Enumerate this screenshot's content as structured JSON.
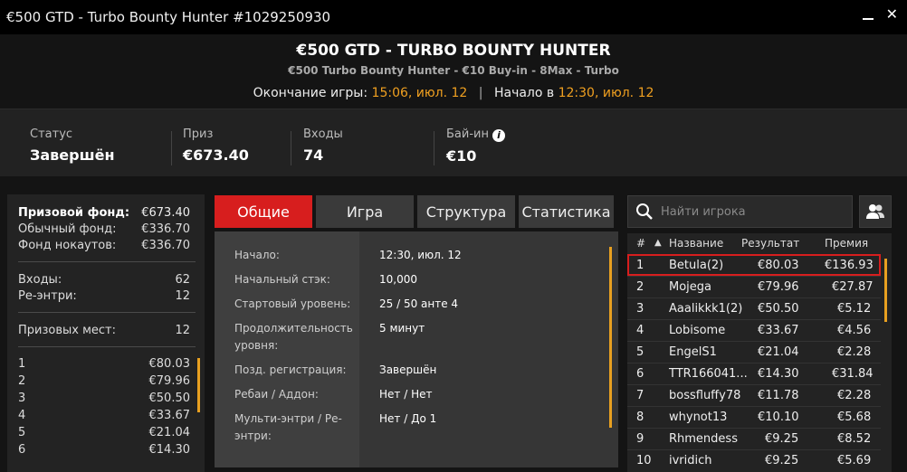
{
  "window": {
    "title": "€500 GTD - Turbo Bounty Hunter #1029250930"
  },
  "header": {
    "title": "€500 GTD - TURBO BOUNTY HUNTER",
    "subtitle": "€500 Turbo Bounty Hunter - €10 Buy-in - 8Max - Turbo",
    "end_label": "Окончание игры:",
    "end_value": "15:06, июл. 12",
    "start_label": "Начало в",
    "start_value": "12:30, июл. 12"
  },
  "info": {
    "status_label": "Статус",
    "status_value": "Завершён",
    "prize_label": "Приз",
    "prize_value": "€673.40",
    "entries_label": "Входы",
    "entries_value": "74",
    "buyin_label": "Бай-ин",
    "buyin_value": "€10"
  },
  "summary": {
    "prize_pool_label": "Призовой фонд:",
    "prize_pool_value": "€673.40",
    "regular_label": "Обычный фонд:",
    "regular_value": "€336.70",
    "ko_label": "Фонд нокаутов:",
    "ko_value": "€336.70",
    "entries_label": "Входы:",
    "entries_value": "62",
    "reentries_label": "Ре-энтри:",
    "reentries_value": "12",
    "paid_label": "Призовых мест:",
    "paid_value": "12",
    "payouts": [
      {
        "place": "1",
        "amount": "€80.03"
      },
      {
        "place": "2",
        "amount": "€79.96"
      },
      {
        "place": "3",
        "amount": "€50.50"
      },
      {
        "place": "4",
        "amount": "€33.67"
      },
      {
        "place": "5",
        "amount": "€21.04"
      },
      {
        "place": "6",
        "amount": "€14.30"
      }
    ]
  },
  "tabs": [
    {
      "label": "Общие"
    },
    {
      "label": "Игра"
    },
    {
      "label": "Структура"
    },
    {
      "label": "Статистика"
    }
  ],
  "details": [
    {
      "label": "Начало:",
      "value": "12:30, июл. 12"
    },
    {
      "label": "Начальный стэк:",
      "value": "10,000"
    },
    {
      "label": "Стартовый уровень:",
      "value": "25 / 50 анте 4"
    },
    {
      "label": "Продолжительность уровня:",
      "value": "5 минут"
    },
    {
      "label": "Позд. регистрация:",
      "value": "Завершён"
    },
    {
      "label": "Ребаи / Аддон:",
      "value": "Нет / Нет"
    },
    {
      "label": "Мульти-энтри / Ре-энтри:",
      "value": "Нет / До 1"
    }
  ],
  "search": {
    "placeholder": "Найти игрока"
  },
  "players": {
    "headers": {
      "num": "#",
      "name": "Название",
      "result": "Результат",
      "prize": "Премия",
      "sort_arrow": "▲"
    },
    "rows": [
      {
        "pos": "1",
        "name": "Betula(2)",
        "result": "€80.03",
        "prize": "€136.93"
      },
      {
        "pos": "2",
        "name": "Mojega",
        "result": "€79.96",
        "prize": "€27.87"
      },
      {
        "pos": "3",
        "name": "Aaalikkk1(2)",
        "result": "€50.50",
        "prize": "€5.12"
      },
      {
        "pos": "4",
        "name": "Lobisome",
        "result": "€33.67",
        "prize": "€4.56"
      },
      {
        "pos": "5",
        "name": "EngelS1",
        "result": "€21.04",
        "prize": "€2.28"
      },
      {
        "pos": "6",
        "name": "TTR166041...",
        "result": "€14.30",
        "prize": "€31.84"
      },
      {
        "pos": "7",
        "name": "bossfluffy78",
        "result": "€11.78",
        "prize": "€2.28"
      },
      {
        "pos": "8",
        "name": "whynot13",
        "result": "€10.10",
        "prize": "€5.68"
      },
      {
        "pos": "9",
        "name": "Rhmendess",
        "result": "€9.25",
        "prize": "€8.52"
      },
      {
        "pos": "10",
        "name": "ivridich",
        "result": "€9.25",
        "prize": "€5.69"
      }
    ]
  },
  "colors": {
    "accent": "#d71e1e",
    "highlight": "#f0a020"
  }
}
